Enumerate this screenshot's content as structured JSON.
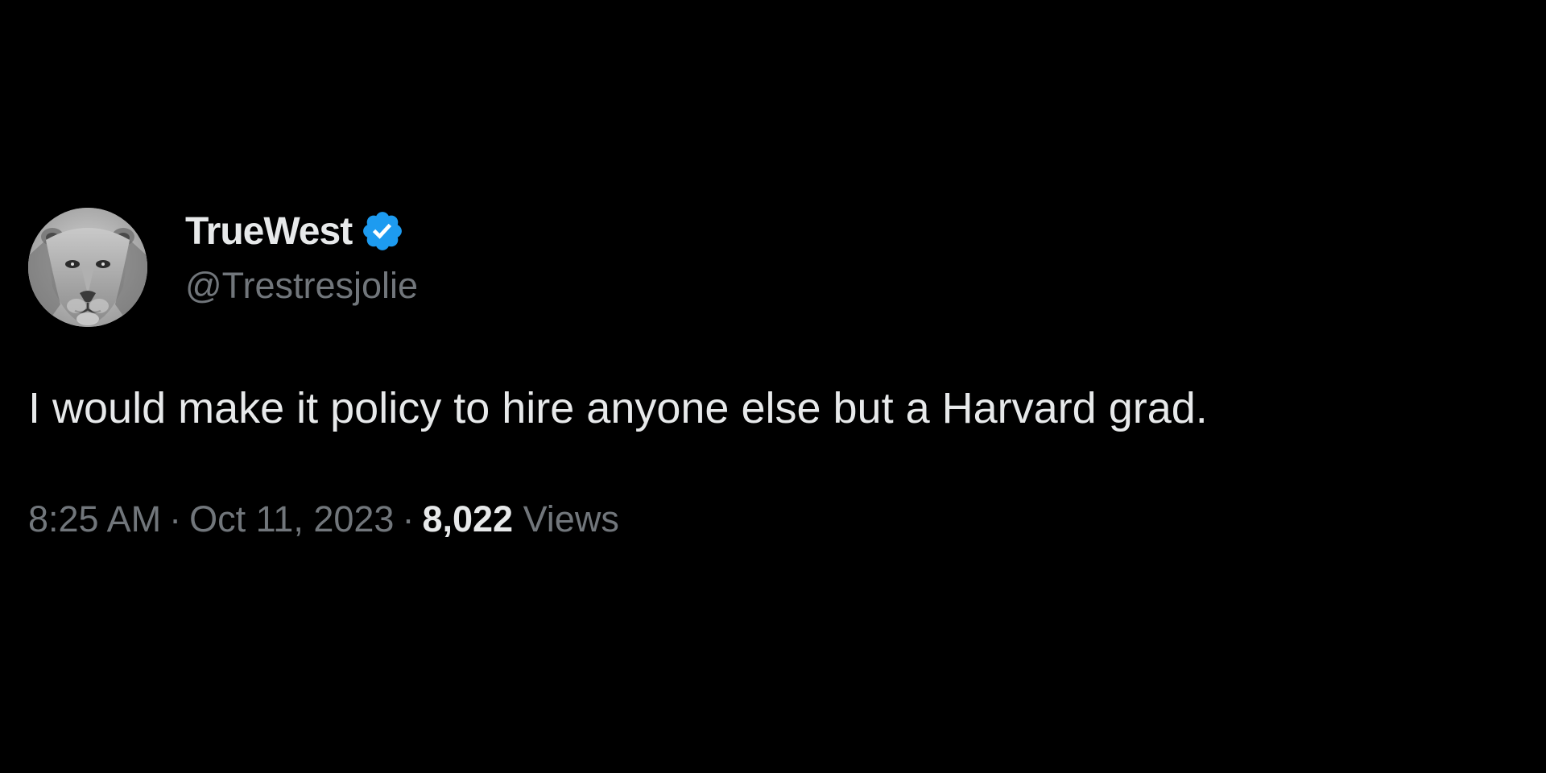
{
  "tweet": {
    "author": {
      "display_name": "TrueWest",
      "handle": "@Trestresjolie",
      "verified": true,
      "avatar": "lioness-photo"
    },
    "text": "I would make it policy to hire anyone else but a Harvard grad.",
    "meta": {
      "time": "8:25 AM",
      "separator": "·",
      "date": "Oct 11, 2023",
      "views_count": "8,022",
      "views_label": "Views"
    }
  },
  "colors": {
    "background": "#000000",
    "primary_text": "#e7e9ea",
    "secondary_text": "#71767b",
    "verified_badge": "#1d9bf0"
  }
}
